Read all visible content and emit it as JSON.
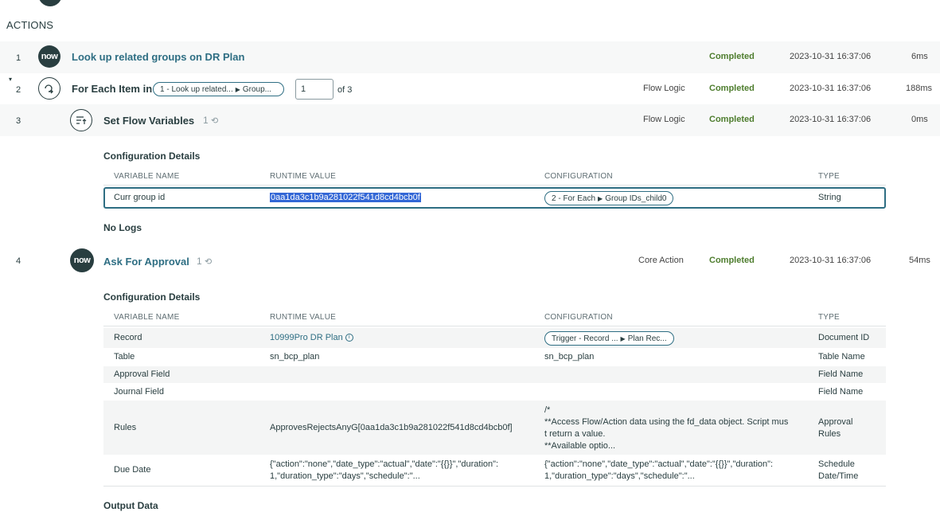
{
  "section_title": "ACTIONS",
  "steps": [
    {
      "num": "1",
      "icon": "now",
      "title": "Look up related groups on DR Plan",
      "category": "",
      "status": "Completed",
      "timestamp": "2023-10-31 16:37:06",
      "duration": "6ms"
    },
    {
      "num": "2",
      "icon": "loop",
      "title": "For Each Item in",
      "category": "Flow Logic",
      "status": "Completed",
      "timestamp": "2023-10-31 16:37:06",
      "duration": "188ms",
      "pill_left": "1 - Look up related...",
      "pill_right": "Group...",
      "iteration_value": "1",
      "iteration_of": "of 3"
    },
    {
      "num": "3",
      "icon": "set-vars",
      "title": "Set Flow Variables",
      "category": "Flow Logic",
      "status": "Completed",
      "timestamp": "2023-10-31 16:37:06",
      "duration": "0ms",
      "count": "1"
    },
    {
      "num": "4",
      "icon": "now",
      "title": "Ask For Approval",
      "category": "Core Action",
      "status": "Completed",
      "timestamp": "2023-10-31 16:37:06",
      "duration": "54ms",
      "count": "1"
    }
  ],
  "now_label": "now",
  "config_title": "Configuration Details",
  "table_headers": {
    "var": "VARIABLE NAME",
    "runtime": "RUNTIME VALUE",
    "config": "CONFIGURATION",
    "type": "TYPE"
  },
  "step3_table": {
    "rows": [
      {
        "name": "Curr group id",
        "value": "0aa1da3c1b9a281022f541d8cd4bcb0f",
        "config_left": "2 - For Each",
        "config_right": "Group IDs_child0",
        "type": "String"
      }
    ]
  },
  "no_logs": "No Logs",
  "step4_table": {
    "rows": [
      {
        "name": "Record",
        "value": "10999Pro DR Plan",
        "config_left": "Trigger - Record ...",
        "config_right": "Plan Rec...",
        "type": "Document ID"
      },
      {
        "name": "Table",
        "value": "sn_bcp_plan",
        "config": "sn_bcp_plan",
        "type": "Table Name"
      },
      {
        "name": "Approval Field",
        "value": "",
        "config": "",
        "type": "Field Name"
      },
      {
        "name": "Journal Field",
        "value": "",
        "config": "",
        "type": "Field Name"
      },
      {
        "name": "Rules",
        "value": "ApprovesRejectsAnyG[0aa1da3c1b9a281022f541d8cd4bcb0f]",
        "config_lines": [
          "/*",
          "**Access Flow/Action data using the fd_data object. Script mus",
          "t return a value.",
          "**Available optio..."
        ],
        "type_lines": [
          "Approval",
          "Rules"
        ]
      },
      {
        "name": "Due Date",
        "value_lines": [
          "{\"action\":\"none\",\"date_type\":\"actual\",\"date\":\"{{}}\",\"duration\":",
          "1,\"duration_type\":\"days\",\"schedule\":\"..."
        ],
        "config_lines": [
          "{\"action\":\"none\",\"date_type\":\"actual\",\"date\":\"{{}}\",\"duration\":",
          "1,\"duration_type\":\"days\",\"schedule\":\"..."
        ],
        "type_lines": [
          "Schedule",
          "Date/Time"
        ]
      }
    ]
  },
  "output_title": "Output Data"
}
